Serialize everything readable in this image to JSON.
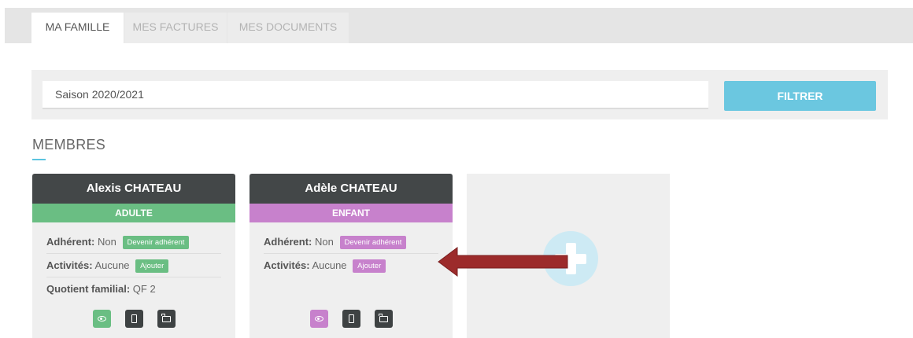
{
  "tabs": [
    {
      "label": "MA FAMILLE",
      "active": true
    },
    {
      "label": "MES FACTURES",
      "active": false
    },
    {
      "label": "MES DOCUMENTS",
      "active": false
    }
  ],
  "filter": {
    "season_value": "Saison 2020/2021",
    "button_label": "FILTRER"
  },
  "section": {
    "title": "MEMBRES"
  },
  "members": [
    {
      "name": "Alexis CHATEAU",
      "type": "ADULTE",
      "adherent_label": "Adhérent:",
      "adherent_value": "Non",
      "adherent_action": "Devenir adhérent",
      "activities_label": "Activités:",
      "activities_value": "Aucune",
      "activities_action": "Ajouter",
      "quotient_label": "Quotient familial:",
      "quotient_value": "QF 2"
    },
    {
      "name": "Adèle CHATEAU",
      "type": "ENFANT",
      "adherent_label": "Adhérent:",
      "adherent_value": "Non",
      "adherent_action": "Devenir adhérent",
      "activities_label": "Activités:",
      "activities_value": "Aucune",
      "activities_action": "Ajouter"
    }
  ],
  "icons": [
    "eye-icon",
    "document-icon",
    "folder-icon",
    "plus-icon",
    "arrow-left-icon"
  ],
  "colors": {
    "adult": "#6abe83",
    "child": "#c781cc",
    "accent": "#6bc7e0",
    "card_header": "#434748",
    "arrow": "#9c2b2b"
  }
}
